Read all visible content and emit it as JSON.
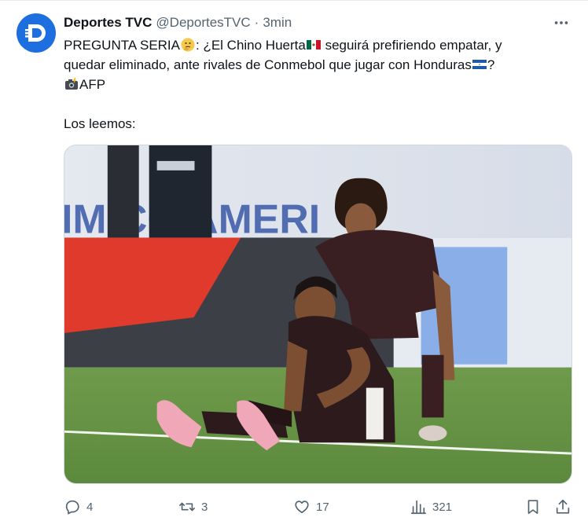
{
  "tweet": {
    "author_name": "Deportes TVC",
    "handle": "@DeportesTVC",
    "separator": "·",
    "time": "3min",
    "text_l1a": "PREGUNTA SERIA",
    "text_l1b": ": ¿El Chino Huerta",
    "text_l1c": " seguirá prefiriendo empatar, y",
    "text_l2a": "quedar eliminado, ante rivales de Conmebol que jugar con Honduras",
    "text_l2b": "?",
    "text_l3": "AFP",
    "text_l5": "Los leemos:"
  },
  "media": {
    "banner_text": "IM   CO   AMERI"
  },
  "actions": {
    "replies": "4",
    "reposts": "3",
    "likes": "17",
    "views": "321"
  },
  "icons": {
    "avatar": "deportes-tvc-logo",
    "more": "more-dots-icon",
    "reply": "reply-icon",
    "repost": "repost-icon",
    "like": "heart-icon",
    "views": "views-bar-chart-icon",
    "bookmark": "bookmark-icon",
    "share": "share-icon"
  },
  "colors": {
    "brand_blue": "#1d6fe0",
    "text": "#0f1419",
    "muted": "#536471"
  }
}
